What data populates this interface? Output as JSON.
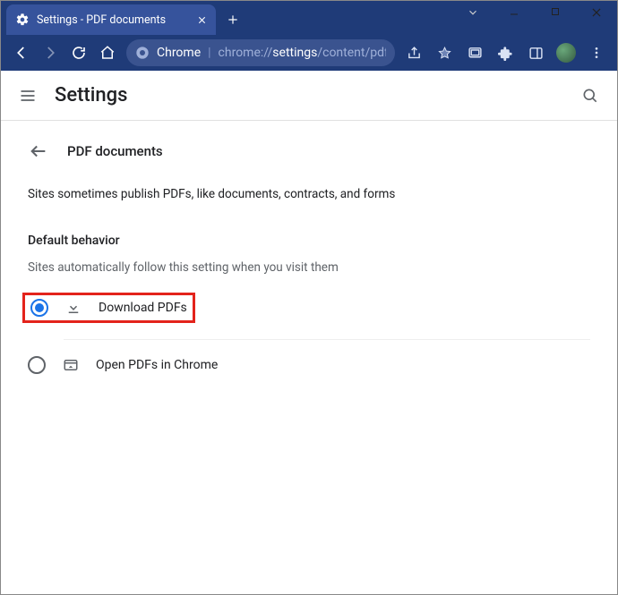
{
  "window": {
    "tab_title": "Settings - PDF documents"
  },
  "addressbar": {
    "chrome_label": "Chrome",
    "url_prefix": "chrome://",
    "url_bold": "settings",
    "url_suffix": "/content/pdfDo…"
  },
  "header": {
    "title": "Settings"
  },
  "page": {
    "title": "PDF documents",
    "description": "Sites sometimes publish PDFs, like documents, contracts, and forms",
    "section": "Default behavior",
    "section_desc": "Sites automatically follow this setting when you visit them",
    "options": {
      "download": "Download PDFs",
      "open": "Open PDFs in Chrome"
    }
  }
}
